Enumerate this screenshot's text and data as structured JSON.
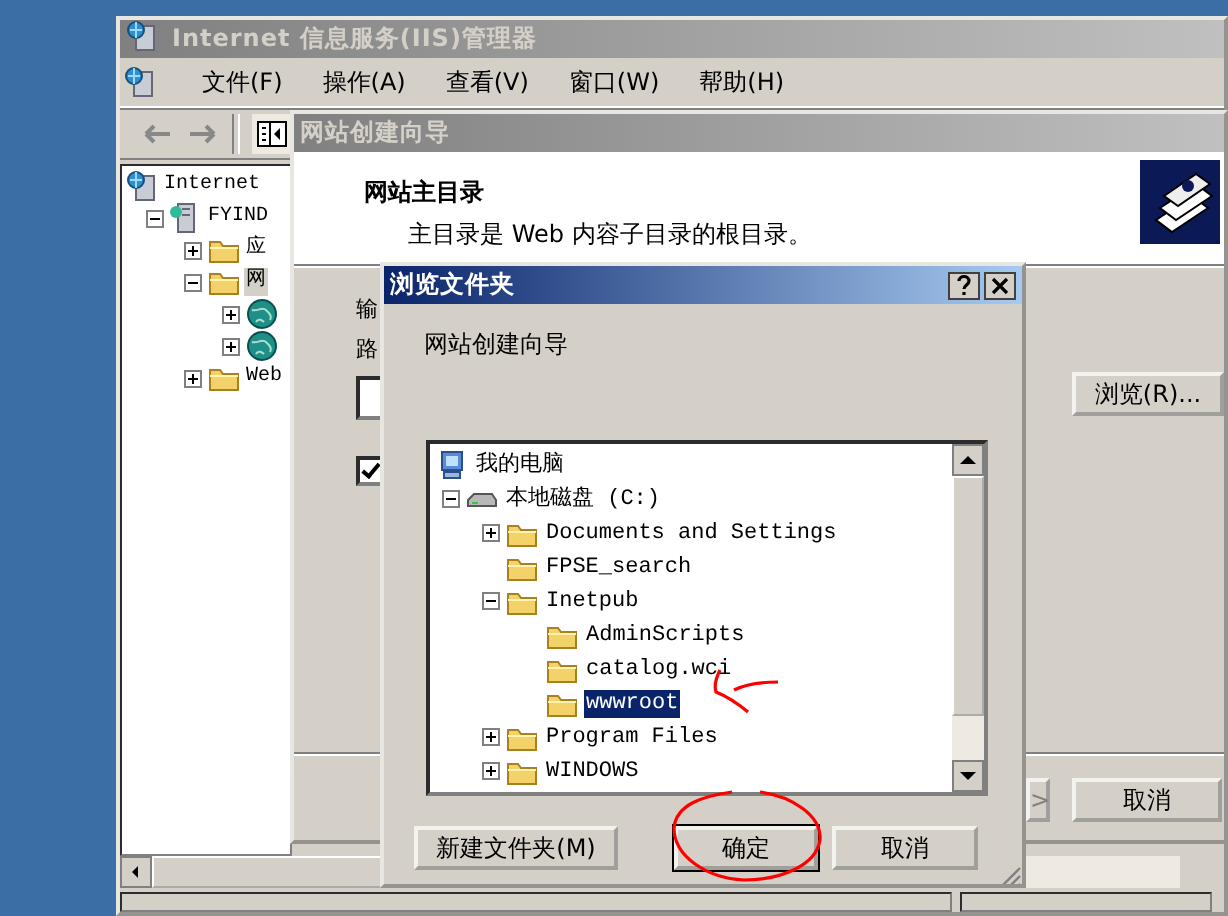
{
  "main_window": {
    "title": "Internet 信息服务(IIS)管理器",
    "menu": [
      {
        "label": "文件(F)"
      },
      {
        "label": "操作(A)"
      },
      {
        "label": "查看(V)"
      },
      {
        "label": "窗口(W)"
      },
      {
        "label": "帮助(H)"
      }
    ],
    "tree": [
      {
        "kind": "root",
        "label": "Internet",
        "selected": false,
        "children": [
          {
            "kind": "server",
            "label": "FYIND",
            "expanded": true,
            "selected": false,
            "children": [
              {
                "kind": "folder",
                "label": "应",
                "expanded": false,
                "selected": false
              },
              {
                "kind": "folder",
                "label": "网",
                "expanded": true,
                "selected": true,
                "children": [
                  {
                    "kind": "globe",
                    "expanded": false,
                    "selected": false
                  },
                  {
                    "kind": "globe",
                    "expanded": false,
                    "selected": false
                  }
                ]
              },
              {
                "kind": "folder",
                "label": "Web",
                "expanded": false,
                "selected": false
              }
            ]
          }
        ]
      }
    ]
  },
  "wizard": {
    "title": "网站创建向导",
    "heading": "网站主目录",
    "description": "主目录是 Web 内容子目录的根目录。",
    "labels": [
      "输",
      "路"
    ],
    "checkbox": {
      "checked": true
    },
    "browse_button": "浏览(R)...",
    "buttons": [
      {
        "label": ">"
      },
      {
        "label": "取消"
      }
    ]
  },
  "dialog": {
    "title": "浏览文件夹",
    "prompt": "网站创建向导",
    "tree": [
      {
        "kind": "computer",
        "label": "我的电脑",
        "selected": false,
        "children": [
          {
            "kind": "drive",
            "label": "本地磁盘 (C:)",
            "expanded": true,
            "selected": false,
            "children": [
              {
                "kind": "folder",
                "label": "Documents and Settings",
                "expanded": false,
                "selected": false
              },
              {
                "kind": "leaf_folder",
                "label": "FPSE_search",
                "selected": false
              },
              {
                "kind": "folder",
                "label": "Inetpub",
                "expanded": true,
                "selected": false,
                "children": [
                  {
                    "kind": "leaf_folder",
                    "label": "AdminScripts",
                    "selected": false
                  },
                  {
                    "kind": "leaf_folder",
                    "label": "catalog.wci",
                    "selected": false
                  },
                  {
                    "kind": "leaf_folder",
                    "label": "wwwroot",
                    "selected": true
                  }
                ]
              },
              {
                "kind": "folder",
                "label": "Program Files",
                "expanded": false,
                "selected": false
              },
              {
                "kind": "folder",
                "label": "WINDOWS",
                "expanded": false,
                "selected": false
              }
            ]
          }
        ]
      }
    ],
    "buttons": [
      {
        "label": "新建文件夹(M)",
        "default": false
      },
      {
        "label": "确定",
        "default": true
      },
      {
        "label": "取消",
        "default": false
      }
    ]
  },
  "annotations": [
    {
      "kind": "arrow"
    },
    {
      "kind": "circle"
    }
  ]
}
